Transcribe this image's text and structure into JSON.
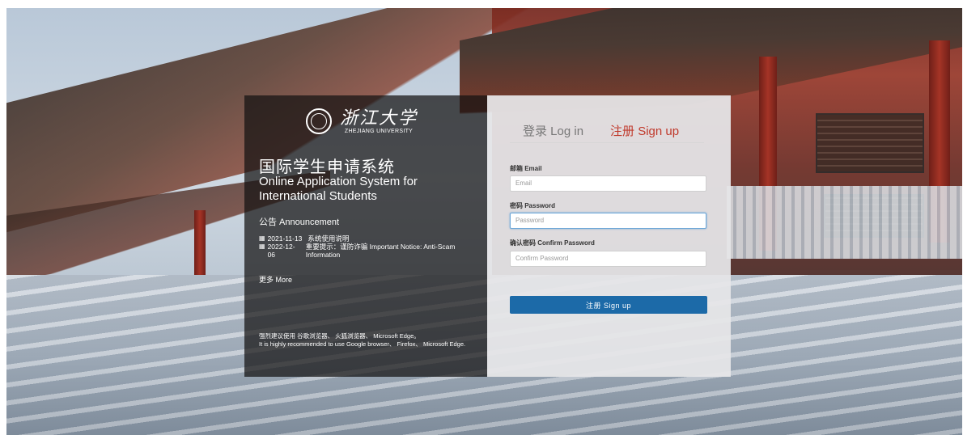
{
  "brand": {
    "logo_cn": "浙江大学",
    "logo_en": "ZHEJIANG UNIVERSITY"
  },
  "intro": {
    "title_cn": "国际学生申请系统",
    "title_en_line1": "Online Application System for",
    "title_en_line2": "International Students",
    "announcement_title": "公告 Announcement",
    "announcements": [
      {
        "date": "2021-11-13",
        "text": "系统使用说明"
      },
      {
        "date": "2022-12-06",
        "text": "重要提示：谨防诈骗 Important Notice: Anti-Scam Information"
      }
    ],
    "more": "更多 More",
    "recommend_cn": "强烈建议使用 谷歌浏览器、 火狐浏览器、 Microsoft Edge。",
    "recommend_en": "It is highly recommended to use Google browser、 Firefox、 Microsoft Edge."
  },
  "form": {
    "tab_login": "登录 Log in",
    "tab_signup": "注册 Sign up",
    "email_label": "邮箱 Email",
    "email_placeholder": "Email",
    "password_label": "密码 Password",
    "password_placeholder": "Password",
    "confirm_label": "确认密码 Confirm Password",
    "confirm_placeholder": "Confirm Password",
    "submit": "注册 Sign up"
  },
  "icons": {
    "calendar": "calendar-icon",
    "seal": "university-seal-icon"
  },
  "colors": {
    "accent": "#1c6aa8",
    "signup_tab": "#c0392b"
  }
}
